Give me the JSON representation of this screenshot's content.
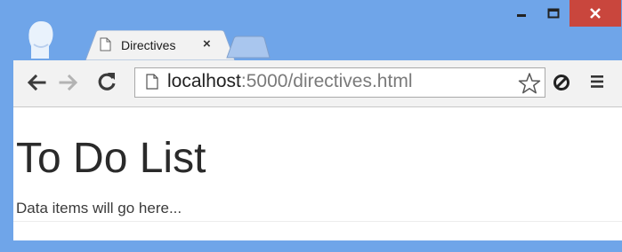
{
  "tab": {
    "title": "Directives",
    "close": "×",
    "page_icon": "page-icon"
  },
  "window_controls": {
    "minimize_icon": "minimize-icon",
    "maximize_icon": "maximize-icon",
    "close_icon": "close-icon"
  },
  "toolbar": {
    "back_icon": "back-arrow-icon",
    "forward_icon": "forward-arrow-icon",
    "reload_icon": "reload-icon",
    "url_host": "localhost",
    "url_rest": ":5000/directives.html",
    "bookmark_icon": "star-icon",
    "extension_icon": "extension-icon",
    "menu_icon": "hamburger-menu-icon"
  },
  "page": {
    "heading": "To Do List",
    "text": "Data items will go here..."
  },
  "colors": {
    "frame": "#6fa5e9",
    "close_button": "#c9463d",
    "toolbar": "#f2f2f2",
    "page_background": "#ffffff"
  }
}
